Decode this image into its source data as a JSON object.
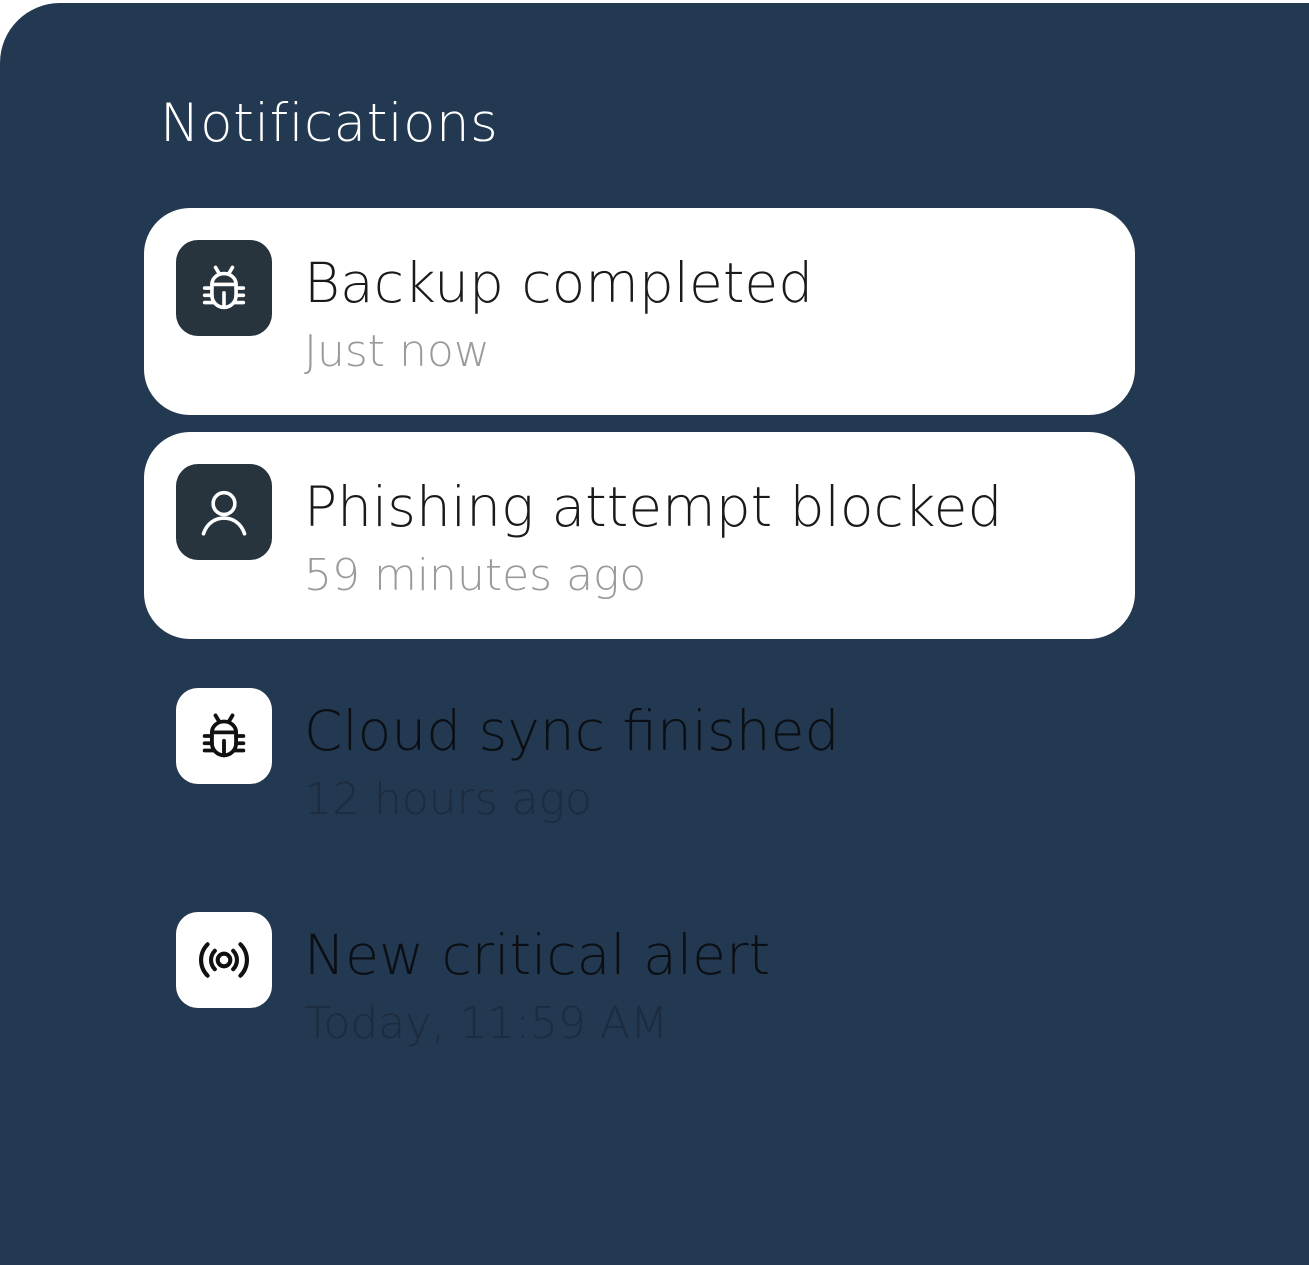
{
  "panel": {
    "title": "Notifications"
  },
  "notifications": [
    {
      "title": "Backup completed",
      "time": "Just now",
      "icon": "bug-icon",
      "style": "card"
    },
    {
      "title": "Phishing attempt blocked",
      "time": "59 minutes ago",
      "icon": "user-icon",
      "style": "card"
    },
    {
      "title": "Cloud sync finished",
      "time": "12 hours ago",
      "icon": "bug-icon",
      "style": "plain"
    },
    {
      "title": "New critical alert",
      "time": "Today, 11:59 AM",
      "icon": "broadcast-icon",
      "style": "plain"
    }
  ],
  "colors": {
    "panel_bg": "#233851",
    "card_bg": "#ffffff",
    "icon_tile_dark": "#27333d",
    "timestamp_gray": "#9a9a9a"
  }
}
